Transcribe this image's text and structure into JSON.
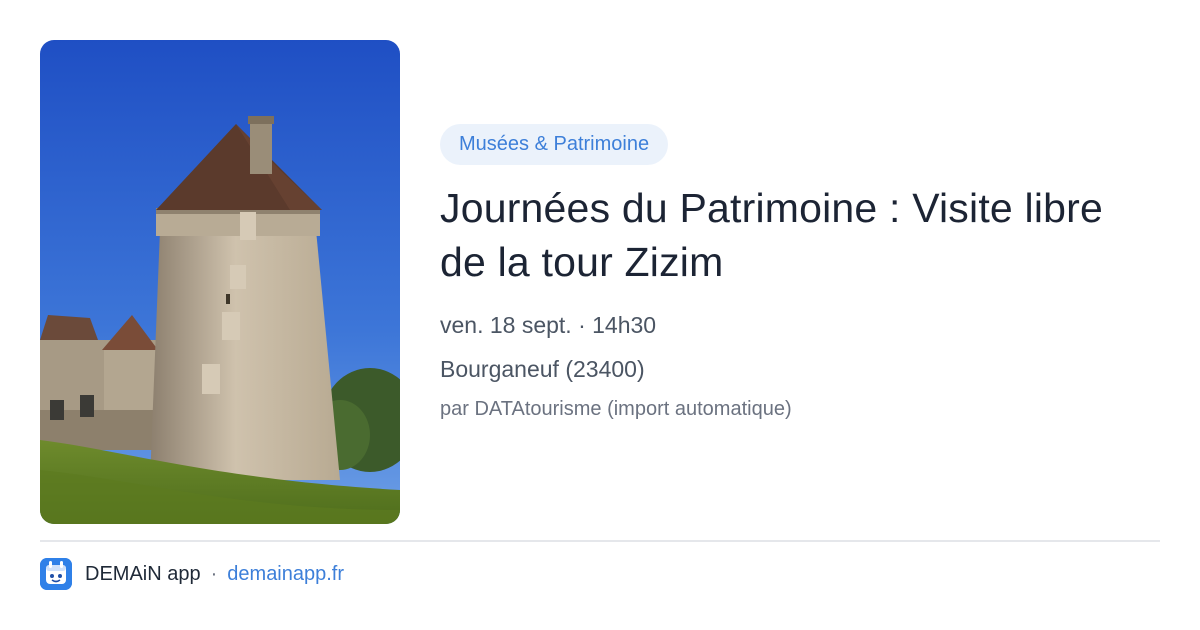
{
  "event": {
    "category": "Musées & Patrimoine",
    "title": "Journées du Patrimoine : Visite libre de la tour Zizim",
    "date": "ven. 18 sept. · 14h30",
    "location": "Bourganeuf (23400)",
    "source": "par DATAtourisme (import automatique)",
    "image_icon": "tower-photo"
  },
  "footer": {
    "app_name": "DEMAiN app",
    "separator": "·",
    "url": "demainapp.fr",
    "logo_icon": "demain-logo-icon"
  },
  "colors": {
    "accent": "#3d7fd9",
    "badge_bg": "#ebf2fb",
    "logo_bg": "#2f80e8"
  }
}
